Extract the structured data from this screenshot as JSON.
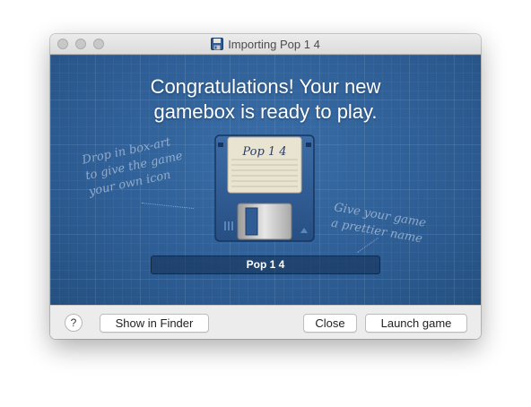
{
  "window": {
    "title": "Importing Pop 1 4",
    "title_icon": "floppy-disk-icon"
  },
  "main": {
    "headline_line1": "Congratulations! Your new",
    "headline_line2": "gamebox is ready to play.",
    "hint_boxart": "Drop in box-art\nto give the game\nyour own icon",
    "hint_name": "Give your game\na prettier name",
    "disk_label": "Pop 1 4",
    "game_name_value": "Pop 1 4"
  },
  "footer": {
    "help_label": "?",
    "show_in_finder_label": "Show in Finder",
    "close_label": "Close",
    "launch_label": "Launch game"
  },
  "colors": {
    "background": "#2d5f97",
    "floppy_body": "#2f5c95",
    "label": "#e9e4d2"
  }
}
